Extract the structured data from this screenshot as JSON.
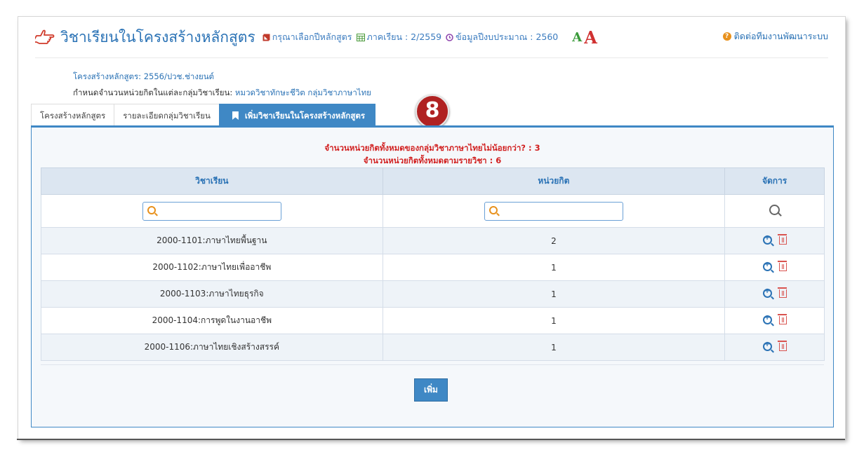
{
  "header": {
    "icon": "pointing-hand-icon",
    "title": "วิชาเรียนในโครงสร้างหลักสูตร",
    "select_year": "กรุณาเลือกปีหลักสูตร",
    "semester": "ภาคเรียน : 2/2559",
    "budget": "ข้อมูลปีงบประมาณ : 2560",
    "font_small": "A",
    "font_large": "A",
    "contact": "ติดต่อทีมงานพัฒนาระบบ"
  },
  "info": {
    "structure": "โครงสร้างหลักสูตร: 2556/ปวช.ช่างยนต์",
    "credit_label": "กำหนดจำนวนหน่วยกิตในแต่ละกลุ่มวิชาเรียน:",
    "credit_value": "หมวดวิชาทักษะชีวิต กลุ่มวิชาภาษาไทย"
  },
  "tabs": [
    {
      "label": "โครงสร้างหลักสูตร"
    },
    {
      "label": "รายละเอียดกลุ่มวิชาเรียน"
    },
    {
      "label": "เพิ่มวิชาเรียนในโครงสร้างหลักสูตร"
    }
  ],
  "badge": "8",
  "warnings": {
    "line1": "จำนวนหน่วยกิตทั้งหมดของกลุ่มวิชาภาษาไทยไม่น้อยกว่า? : 3",
    "line2": "จำนวนหน่วยกิตทั้งหมดตามรายวิชา : 6"
  },
  "table": {
    "columns": [
      "วิชาเรียน",
      "หน่วยกิต",
      "จัดการ"
    ],
    "rows": [
      {
        "subject": "2000-1101:ภาษาไทยพื้นฐาน",
        "credits": "2"
      },
      {
        "subject": "2000-1102:ภาษาไทยเพื่ออาชีพ",
        "credits": "1"
      },
      {
        "subject": "2000-1103:ภาษาไทยธุรกิจ",
        "credits": "1"
      },
      {
        "subject": "2000-1104:การพูดในงานอาชีพ",
        "credits": "1"
      },
      {
        "subject": "2000-1106:ภาษาไทยเชิงสร้างสรรค์",
        "credits": "1"
      }
    ]
  },
  "add_button": "เพิ่ม",
  "colors": {
    "accent": "#3f88c5",
    "warning": "#d11f1f",
    "delete": "#d9534f"
  }
}
